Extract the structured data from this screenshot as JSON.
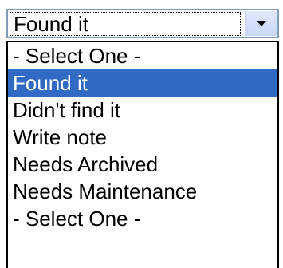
{
  "select": {
    "current_value": "Found it",
    "arrow_icon": "chevron-down-icon",
    "options": [
      "- Select One -",
      "Found it",
      "Didn't find it",
      "Write note",
      "Needs Archived",
      "Needs Maintenance",
      "- Select One -"
    ],
    "selected_index": 1
  },
  "colors": {
    "highlight": "#316ac5",
    "highlight_text": "#ffffff",
    "border": "#7f9db9"
  }
}
